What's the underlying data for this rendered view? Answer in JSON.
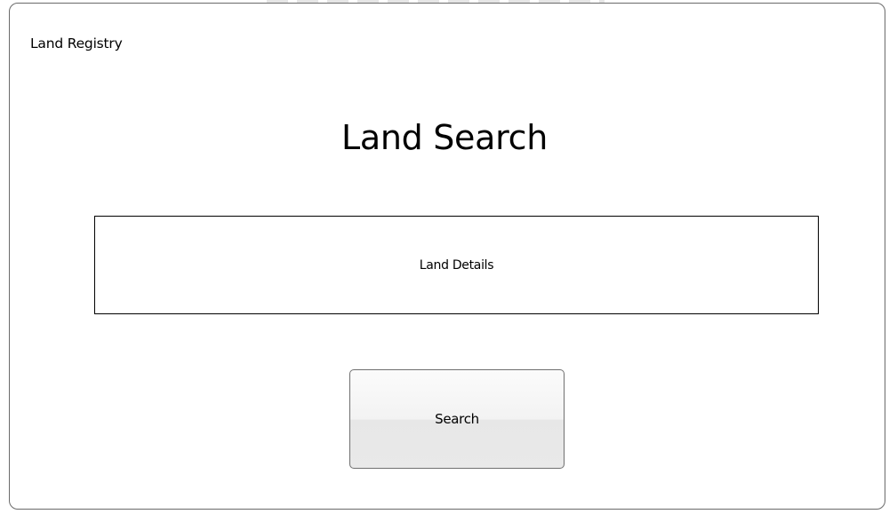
{
  "window": {
    "app_title": "Land Registry",
    "page_title": "Land Search"
  },
  "details_panel": {
    "label": "Land Details"
  },
  "actions": {
    "search_label": "Search"
  }
}
